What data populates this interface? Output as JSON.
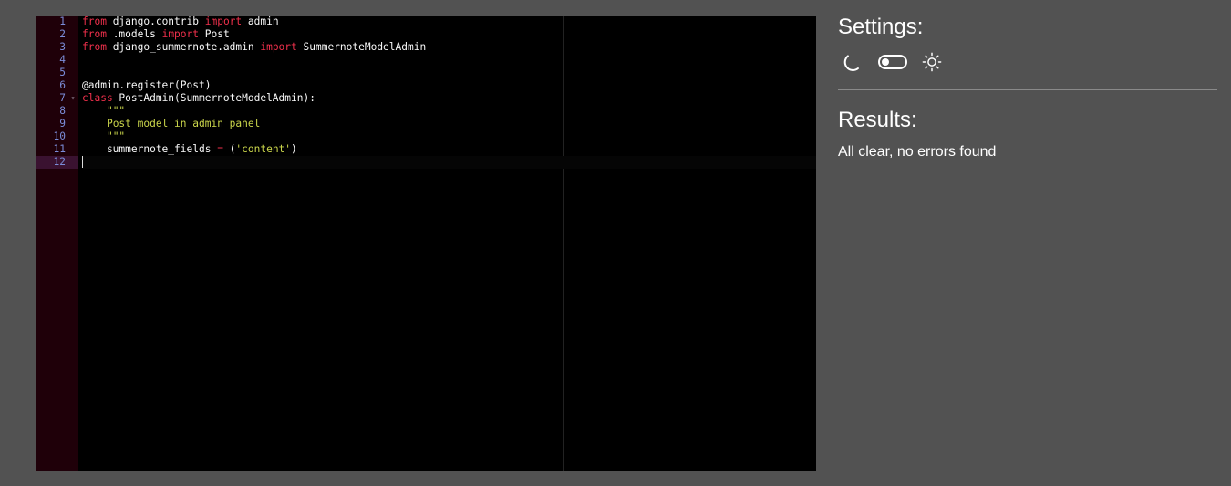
{
  "editor": {
    "lines": [
      {
        "number": "1",
        "tokens": [
          {
            "t": "from",
            "c": "kw"
          },
          {
            "t": " django.contrib "
          },
          {
            "t": "import",
            "c": "kw"
          },
          {
            "t": " admin"
          }
        ]
      },
      {
        "number": "2",
        "tokens": [
          {
            "t": "from",
            "c": "kw"
          },
          {
            "t": " .models "
          },
          {
            "t": "import",
            "c": "kw"
          },
          {
            "t": " Post"
          }
        ]
      },
      {
        "number": "3",
        "tokens": [
          {
            "t": "from",
            "c": "kw"
          },
          {
            "t": " django_summernote.admin "
          },
          {
            "t": "import",
            "c": "kw"
          },
          {
            "t": " SummernoteModelAdmin"
          }
        ]
      },
      {
        "number": "4",
        "tokens": []
      },
      {
        "number": "5",
        "tokens": []
      },
      {
        "number": "6",
        "tokens": [
          {
            "t": "@admin.register(Post)"
          }
        ]
      },
      {
        "number": "7",
        "fold": "▾",
        "tokens": [
          {
            "t": "class",
            "c": "kw"
          },
          {
            "t": " PostAdmin(SummernoteModelAdmin):"
          }
        ]
      },
      {
        "number": "8",
        "tokens": [
          {
            "t": "    "
          },
          {
            "t": "\"\"\"",
            "c": "str"
          }
        ]
      },
      {
        "number": "9",
        "tokens": [
          {
            "t": "    "
          },
          {
            "t": "Post model in admin panel",
            "c": "str"
          }
        ]
      },
      {
        "number": "10",
        "tokens": [
          {
            "t": "    "
          },
          {
            "t": "\"\"\"",
            "c": "str"
          }
        ]
      },
      {
        "number": "11",
        "tokens": [
          {
            "t": "    summernote_fields "
          },
          {
            "t": "=",
            "c": "op"
          },
          {
            "t": " ("
          },
          {
            "t": "'content'",
            "c": "str"
          },
          {
            "t": ")"
          }
        ]
      },
      {
        "number": "12",
        "active": true,
        "cursor": true,
        "tokens": []
      }
    ],
    "colors": {
      "background": "#000000",
      "gutter": "#1f0009",
      "keyword": "#f0304c",
      "string": "#cbd64b",
      "line_number": "#7b8cd8"
    }
  },
  "settings": {
    "heading": "Settings:",
    "dark_mode_icon": "moon-icon",
    "light_mode_icon": "sun-icon",
    "theme_toggle_on": false
  },
  "results": {
    "heading": "Results:",
    "message": "All clear, no errors found"
  }
}
